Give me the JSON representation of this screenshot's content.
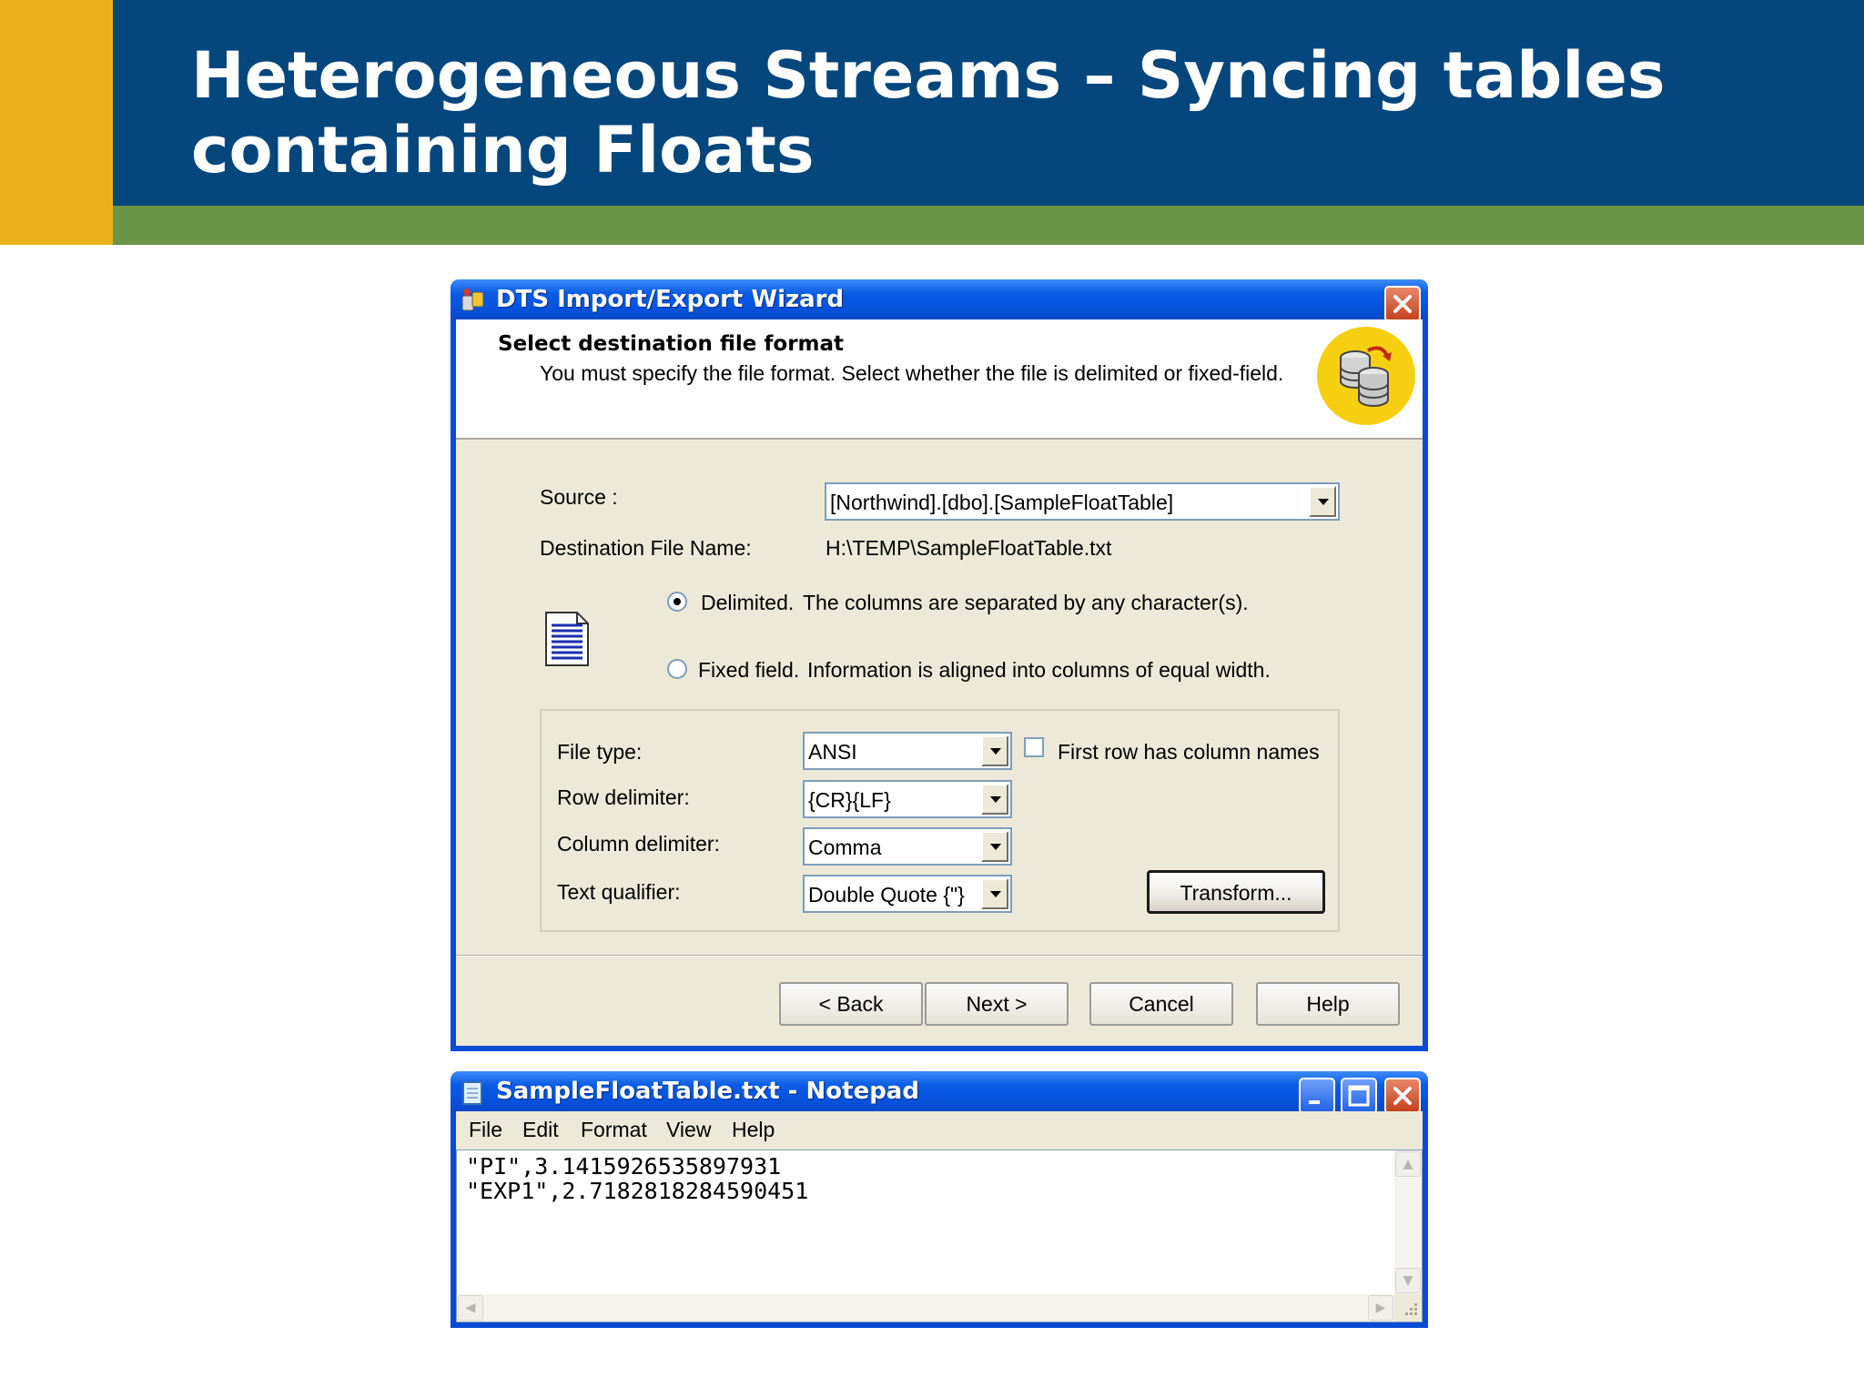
{
  "slide": {
    "title": "Heterogeneous Streams – Syncing tables containing Floats"
  },
  "wizard": {
    "title": "DTS Import/Export Wizard",
    "heading": "Select destination file format",
    "subheading": "You must specify the file format. Select whether the file is delimited or fixed-field.",
    "source_label": "Source :",
    "source_value": "[Northwind].[dbo].[SampleFloatTable]",
    "dest_label": "Destination File Name:",
    "dest_value": "H:\\TEMP\\SampleFloatTable.txt",
    "format_options": [
      {
        "label": "Delimited.",
        "description": "The columns are separated by any character(s).",
        "selected": true
      },
      {
        "label": "Fixed field.",
        "description": "Information is aligned into columns of equal width.",
        "selected": false
      }
    ],
    "file_type_label": "File type:",
    "file_type_value": "ANSI",
    "first_row_label": "First row has column names",
    "first_row_checked": false,
    "row_delim_label": "Row delimiter:",
    "row_delim_value": "{CR}{LF}",
    "col_delim_label": "Column delimiter:",
    "col_delim_value": "Comma",
    "text_qual_label": "Text qualifier:",
    "text_qual_value": "Double Quote {\"}",
    "transform_label": "Transform...",
    "buttons": {
      "back": "< Back",
      "next": "Next >",
      "cancel": "Cancel",
      "help": "Help"
    }
  },
  "notepad": {
    "title": "SampleFloatTable.txt - Notepad",
    "menu": [
      "File",
      "Edit",
      "Format",
      "View",
      "Help"
    ],
    "lines": [
      "\"PI\",3.1415926535897931",
      "\"EXP1\",2.7182818284590451"
    ]
  },
  "colors": {
    "header_blue": "#05467D",
    "header_gold": "#EBB11C",
    "header_green": "#6A9446",
    "xp_title_blue": "#0A5BE6",
    "dialog_face": "#ECE9D8"
  }
}
